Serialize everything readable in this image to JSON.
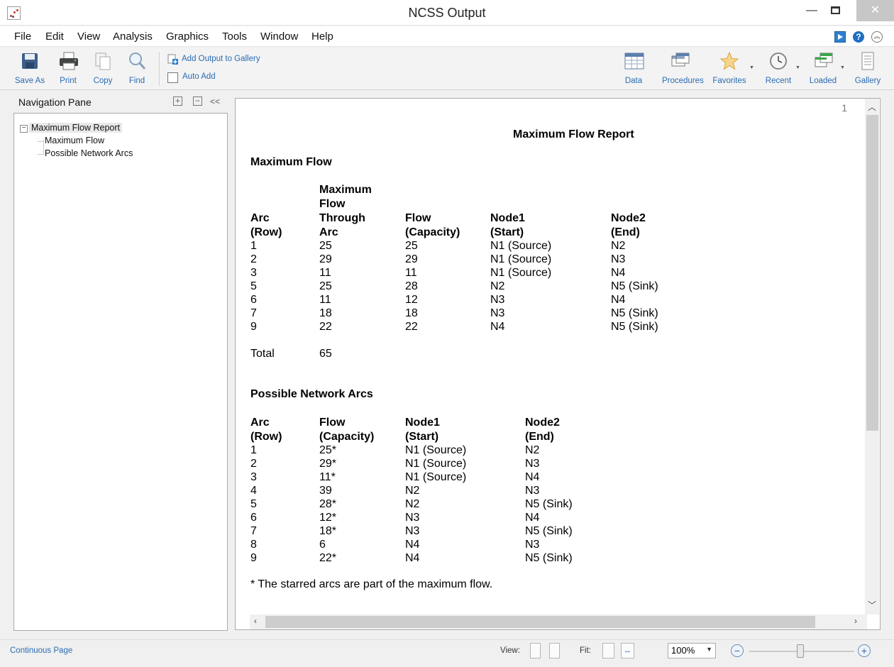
{
  "window": {
    "title": "NCSS Output"
  },
  "menu": [
    "File",
    "Edit",
    "View",
    "Analysis",
    "Graphics",
    "Tools",
    "Window",
    "Help"
  ],
  "toolbar": {
    "save_as": "Save As",
    "print": "Print",
    "copy": "Copy",
    "find": "Find",
    "add_output": "Add Output to Gallery",
    "auto_add": "Auto Add",
    "data": "Data",
    "procedures": "Procedures",
    "favorites": "Favorites",
    "recent": "Recent",
    "loaded": "Loaded",
    "gallery": "Gallery"
  },
  "nav": {
    "title": "Navigation Pane",
    "collapse_symbol": "<<",
    "root": "Maximum Flow Report",
    "children": [
      "Maximum Flow",
      "Possible Network Arcs"
    ]
  },
  "report": {
    "page_number": "1",
    "title": "Maximum Flow Report",
    "max_flow": {
      "title": "Maximum Flow",
      "headers": [
        [
          "Arc",
          "(Row)"
        ],
        [
          "Maximum",
          "Flow",
          "Through",
          "Arc"
        ],
        [
          "Flow",
          "(Capacity)"
        ],
        [
          "Node1",
          "(Start)"
        ],
        [
          "Node2",
          "(End)"
        ]
      ],
      "rows": [
        [
          "1",
          "25",
          "25",
          "N1 (Source)",
          "N2"
        ],
        [
          "2",
          "29",
          "29",
          "N1 (Source)",
          "N3"
        ],
        [
          "3",
          "11",
          "11",
          "N1 (Source)",
          "N4"
        ],
        [
          "5",
          "25",
          "28",
          "N2",
          "N5 (Sink)"
        ],
        [
          "6",
          "11",
          "12",
          "N3",
          "N4"
        ],
        [
          "7",
          "18",
          "18",
          "N3",
          "N5 (Sink)"
        ],
        [
          "9",
          "22",
          "22",
          "N4",
          "N5 (Sink)"
        ]
      ],
      "total_label": "Total",
      "total_value": "65"
    },
    "network_arcs": {
      "title": "Possible Network Arcs",
      "headers": [
        [
          "Arc",
          "(Row)"
        ],
        [
          "Flow",
          "(Capacity)"
        ],
        [
          "Node1",
          "(Start)"
        ],
        [
          "Node2",
          "(End)"
        ]
      ],
      "rows": [
        [
          "1",
          "25*",
          "N1 (Source)",
          "N2"
        ],
        [
          "2",
          "29*",
          "N1 (Source)",
          "N3"
        ],
        [
          "3",
          "11*",
          "N1 (Source)",
          "N4"
        ],
        [
          "4",
          "39",
          "N2",
          "N3"
        ],
        [
          "5",
          "28*",
          "N2",
          "N5 (Sink)"
        ],
        [
          "6",
          "12*",
          "N3",
          "N4"
        ],
        [
          "7",
          "18*",
          "N3",
          "N5 (Sink)"
        ],
        [
          "8",
          "6",
          "N4",
          "N3"
        ],
        [
          "9",
          "22*",
          "N4",
          "N5 (Sink)"
        ]
      ],
      "footnote": "* The starred arcs are part of the maximum flow."
    }
  },
  "status": {
    "mode": "Continuous Page",
    "view_label": "View:",
    "fit_label": "Fit:",
    "zoom": "100%"
  },
  "colors": {
    "accent_link": "#2a6bb3",
    "help_blue": "#1e6fc4"
  }
}
